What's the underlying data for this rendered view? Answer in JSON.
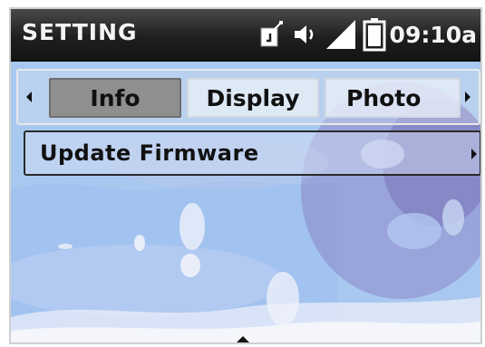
{
  "header": {
    "title": "SETTING",
    "time": "09:10a",
    "icons": [
      "card-icon",
      "speaker-icon",
      "signal-icon",
      "battery-icon"
    ]
  },
  "tabs": {
    "items": [
      {
        "label": "Info",
        "active": true
      },
      {
        "label": "Display",
        "active": false
      },
      {
        "label": "Photo",
        "active": false
      }
    ]
  },
  "menu": {
    "items": [
      {
        "label": "Update Firmware"
      }
    ]
  },
  "colors": {
    "status_bar": "#1f1f1f",
    "active_tab": "#8f8f8f",
    "wallpaper_base": "#a7c7ef"
  }
}
